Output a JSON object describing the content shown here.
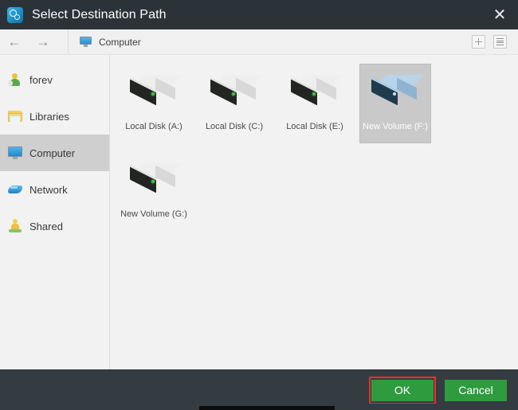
{
  "window": {
    "title": "Select Destination Path",
    "app_icon": "app-clock-gear-icon",
    "close_label": "✕",
    "titlebar_color": "#2b3338",
    "chrome_color": "#343c41"
  },
  "toolbar": {
    "back_label": "←",
    "forward_label": "→",
    "breadcrumb": "Computer",
    "breadcrumb_icon": "monitor-icon",
    "new_folder_icon": "plus-icon",
    "view_mode_icon": "list-view-icon"
  },
  "sidebar": {
    "items": [
      {
        "label": "forev",
        "icon": "user-icon",
        "selected": false
      },
      {
        "label": "Libraries",
        "icon": "library-icon",
        "selected": false
      },
      {
        "label": "Computer",
        "icon": "monitor-icon",
        "selected": true
      },
      {
        "label": "Network",
        "icon": "network-icon",
        "selected": false
      },
      {
        "label": "Shared",
        "icon": "shared-icon",
        "selected": false
      }
    ]
  },
  "content": {
    "drives": [
      {
        "label": "Local Disk (A:)",
        "icon": "hard-drive-icon",
        "selected": false
      },
      {
        "label": "Local Disk (C:)",
        "icon": "hard-drive-icon",
        "selected": false
      },
      {
        "label": "Local Disk (E:)",
        "icon": "hard-drive-icon",
        "selected": false
      },
      {
        "label": "New Volume (F:)",
        "icon": "hard-drive-selected-icon",
        "selected": true
      },
      {
        "label": "New Volume (G:)",
        "icon": "hard-drive-icon",
        "selected": false
      }
    ]
  },
  "footer": {
    "ok_label": "OK",
    "cancel_label": "Cancel",
    "button_color": "#2e9b3e",
    "highlight_color": "#ee2b2b",
    "ok_highlighted": true
  }
}
